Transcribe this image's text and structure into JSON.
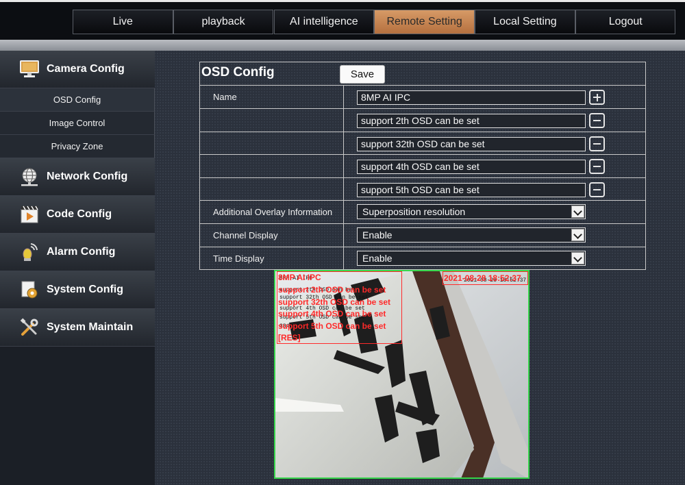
{
  "nav": {
    "items": [
      {
        "label": "Live",
        "active": false
      },
      {
        "label": "playback",
        "active": false
      },
      {
        "label": "AI intelligence",
        "active": false
      },
      {
        "label": "Remote Setting",
        "active": true
      },
      {
        "label": "Local Setting",
        "active": false
      },
      {
        "label": "Logout",
        "active": false
      }
    ]
  },
  "sidebar": {
    "camera_config": "Camera Config",
    "sub_items": [
      "OSD Config",
      "Image Control",
      "Privacy Zone"
    ],
    "network_config": "Network Config",
    "code_config": "Code Config",
    "alarm_config": "Alarm Config",
    "system_config": "System Config",
    "system_maintain": "System Maintain"
  },
  "osd": {
    "title": "OSD Config",
    "save_label": "Save",
    "name_label": "Name",
    "name_value": "8MP AI IPC",
    "extra_lines": [
      "support 2th OSD can be set",
      "support 32th OSD can be set",
      "support 4th OSD can be set",
      "support 5th OSD can be set"
    ],
    "overlay_label": "Additional Overlay Information",
    "overlay_value": "Superposition resolution",
    "channel_label": "Channel Display",
    "channel_value": "Enable",
    "time_label": "Time Display",
    "time_value": "Enable"
  },
  "preview": {
    "red_lines": [
      "8MP AI IPC",
      "support 2th OSD can be set",
      "support 32th OSD can be set",
      "support 4th OSD can be set",
      "support 5th OSD can be set",
      "[RES]"
    ],
    "timestamp_red": "2021-08-28 18:52:37",
    "small_lines": [
      "8MP AI IPC",
      "support 2th OSD can be set",
      "support 32th OSD can be set",
      "support 4th OSD can be set",
      "support 5th OSD can be set",
      "3840x2160"
    ],
    "timestamp_small": "2021-08-28 18:52:37"
  },
  "colors": {
    "active_tab": "#c8834f",
    "preview_border": "#35d44a",
    "osd_text": "#ff2a2a"
  }
}
